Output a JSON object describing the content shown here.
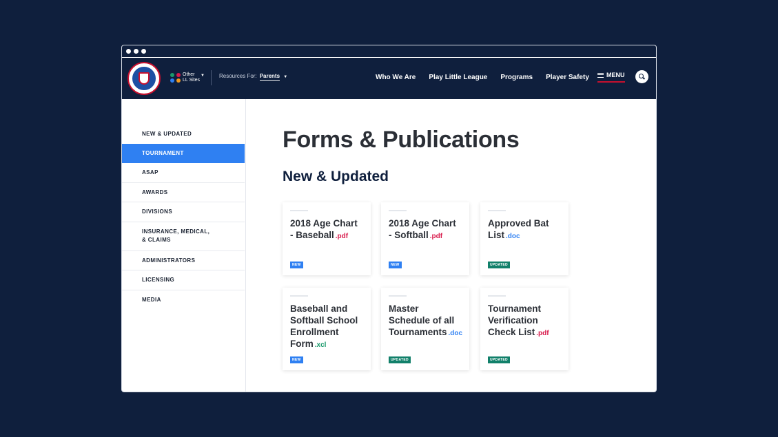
{
  "nav": {
    "other_sites_line1": "Other",
    "other_sites_line2": "LL Sites",
    "resources_label": "Resources For:",
    "resources_value": "Parents",
    "menu_items": [
      "Who We Are",
      "Play Little League",
      "Programs",
      "Player Safety"
    ],
    "menu_button_label": "MENU"
  },
  "sidebar": {
    "items": [
      {
        "label": "NEW & UPDATED"
      },
      {
        "label": "TOURNAMENT"
      },
      {
        "label": "ASAP"
      },
      {
        "label": "AWARDS"
      },
      {
        "label": "DIVISIONS"
      },
      {
        "label_line1": "INSURANCE, MEDICAL,",
        "label_line2": "& CLAIMS"
      },
      {
        "label": "ADMINISTRATORS"
      },
      {
        "label": "LICENSING"
      },
      {
        "label": "MEDIA"
      }
    ]
  },
  "main": {
    "page_title": "Forms & Publications",
    "section_title": "New & Updated",
    "cards": [
      {
        "title": "2018 Age Chart - Baseball",
        "ext": ".pdf",
        "badge": "NEW"
      },
      {
        "title": "2018 Age Chart - Softball",
        "ext": ".pdf",
        "badge": "NEW"
      },
      {
        "title": "Approved Bat List",
        "ext": ".doc",
        "badge": "UPDATED"
      },
      {
        "title": "Baseball and Softball School Enrollment Form",
        "ext": ".xcl",
        "badge": "NEW"
      },
      {
        "title": "Master Schedule of all Tournaments",
        "ext": ".doc",
        "badge": "UPDATED"
      },
      {
        "title": "Tournament Verification Check List",
        "ext": ".pdf",
        "badge": "UPDATED"
      }
    ]
  },
  "colors": {
    "navy": "#0f1f3d",
    "accent_blue": "#2f80f2",
    "pdf_red": "#d81a4b",
    "xcl_green": "#1a9a6c",
    "updated_green": "#11806a",
    "menu_underline": "#c8102e"
  }
}
